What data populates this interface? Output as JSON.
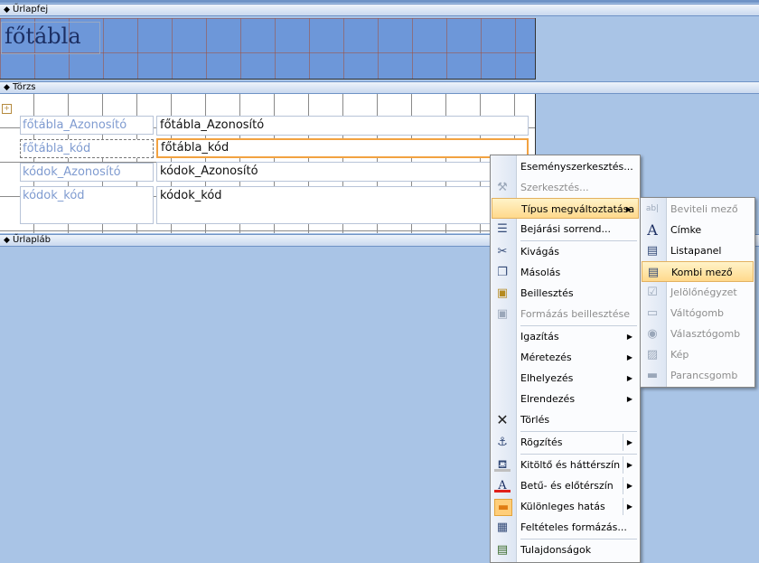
{
  "sections": {
    "header": "Űrlapfej",
    "detail": "Törzs",
    "footer": "Űrlapláb"
  },
  "header_title": "főtábla",
  "fields": [
    {
      "label": "főtábla_Azonosító",
      "value": "főtábla_Azonosító"
    },
    {
      "label": "főtábla_kód",
      "value": "főtábla_kód"
    },
    {
      "label": "kódok_Azonosító",
      "value": "kódok_Azonosító"
    },
    {
      "label": "kódok_kód",
      "value": "kódok_kód"
    }
  ],
  "context_menu": [
    {
      "label": "Eseményszerkesztés...",
      "icon": "blank",
      "disabled": false
    },
    {
      "label": "Szerkesztés...",
      "icon": "wand-icon",
      "disabled": true
    },
    {
      "label": "Típus megváltoztatása",
      "icon": "blank",
      "disabled": false,
      "submenu": true
    },
    {
      "label": "Bejárási sorrend...",
      "icon": "tab-order-icon",
      "disabled": false
    },
    {
      "label": "Kivágás",
      "icon": "scissors-icon",
      "disabled": false
    },
    {
      "label": "Másolás",
      "icon": "copy-icon",
      "disabled": false
    },
    {
      "label": "Beillesztés",
      "icon": "paste-icon",
      "disabled": false
    },
    {
      "label": "Formázás beillesztése",
      "icon": "paste-format-icon",
      "disabled": true
    },
    {
      "label": "Igazítás",
      "icon": "blank",
      "disabled": false,
      "submenu": true
    },
    {
      "label": "Méretezés",
      "icon": "blank",
      "disabled": false,
      "submenu": true
    },
    {
      "label": "Elhelyezés",
      "icon": "blank",
      "disabled": false,
      "submenu": true
    },
    {
      "label": "Elrendezés",
      "icon": "blank",
      "disabled": false,
      "submenu": true
    },
    {
      "label": "Törlés",
      "icon": "delete-x-icon",
      "disabled": false
    },
    {
      "label": "Rögzítés",
      "icon": "anchor-icon",
      "disabled": false,
      "submenu": true
    },
    {
      "label": "Kitöltő és háttérszín",
      "icon": "fill-bucket-icon",
      "disabled": false,
      "submenu": true
    },
    {
      "label": "Betű- és előtérszín",
      "icon": "font-color-icon",
      "disabled": false,
      "submenu": true
    },
    {
      "label": "Különleges hatás",
      "icon": "special-effect-icon",
      "disabled": false,
      "submenu": true
    },
    {
      "label": "Feltételes formázás...",
      "icon": "conditional-format-icon",
      "disabled": false
    },
    {
      "label": "Tulajdonságok",
      "icon": "properties-icon",
      "disabled": false
    }
  ],
  "submenu": [
    {
      "label": "Beviteli mező",
      "icon": "textbox-icon",
      "disabled": true
    },
    {
      "label": "Címke",
      "icon": "label-a-icon",
      "disabled": false
    },
    {
      "label": "Listapanel",
      "icon": "listbox-icon",
      "disabled": false
    },
    {
      "label": "Kombi mező",
      "icon": "combobox-icon",
      "disabled": false
    },
    {
      "label": "Jelölőnégyzet",
      "icon": "checkbox-icon",
      "disabled": true
    },
    {
      "label": "Váltógomb",
      "icon": "toggle-button-icon",
      "disabled": true
    },
    {
      "label": "Választógomb",
      "icon": "radio-button-icon",
      "disabled": true
    },
    {
      "label": "Kép",
      "icon": "image-icon",
      "disabled": true
    },
    {
      "label": "Parancsgomb",
      "icon": "command-button-icon",
      "disabled": true
    }
  ]
}
